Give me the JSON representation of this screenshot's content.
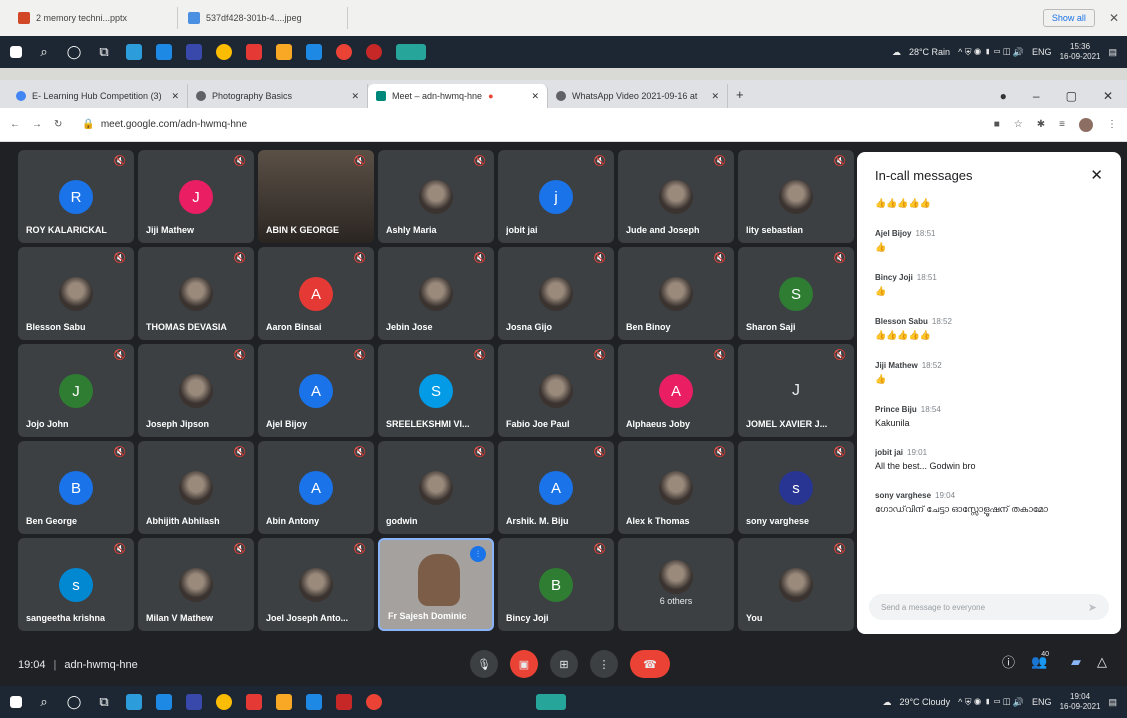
{
  "downloads": {
    "items": [
      "2 memory techni...pptx",
      "537df428-301b-4....jpeg"
    ],
    "show_all": "Show all"
  },
  "taskbar_top": {
    "weather": "28°C Rain",
    "lang": "ENG",
    "time": "15:36",
    "date": "16-09-2021"
  },
  "taskbar_bottom": {
    "weather": "29°C Cloudy",
    "lang": "ENG",
    "time": "19:04",
    "date": "16-09-2021"
  },
  "browser": {
    "tabs": [
      {
        "title": "E- Learning Hub Competition (3)",
        "color": "#4285f4"
      },
      {
        "title": "Photography Basics",
        "color": "#5f6368"
      },
      {
        "title": "Meet – adn-hwmq-hne",
        "color": "#00897b"
      },
      {
        "title": "WhatsApp Video 2021-09-16 at",
        "color": "#5f6368"
      }
    ],
    "url": "meet.google.com/adn-hwmq-hne"
  },
  "meet": {
    "participants": [
      {
        "name": "ROY KALARICKAL",
        "type": "letter",
        "letter": "R",
        "color": "#1a73e8"
      },
      {
        "name": "Jiji Mathew",
        "type": "letter",
        "letter": "J",
        "color": "#e91e63"
      },
      {
        "name": "ABIN K GEORGE",
        "type": "video"
      },
      {
        "name": "Ashly Maria",
        "type": "photo"
      },
      {
        "name": "jobit jai",
        "type": "letter",
        "letter": "j",
        "color": "#1a73e8"
      },
      {
        "name": "Jude and Joseph",
        "type": "photo"
      },
      {
        "name": "lity sebastian",
        "type": "photo"
      },
      {
        "name": "Blesson Sabu",
        "type": "photo"
      },
      {
        "name": "THOMAS DEVASIA",
        "type": "photo"
      },
      {
        "name": "Aaron Binsai",
        "type": "letter",
        "letter": "A",
        "color": "#e53935"
      },
      {
        "name": "Jebin Jose",
        "type": "photo"
      },
      {
        "name": "Josna Gijo",
        "type": "photo"
      },
      {
        "name": "Ben Binoy",
        "type": "photo"
      },
      {
        "name": "Sharon Saji",
        "type": "letter",
        "letter": "S",
        "color": "#2e7d32"
      },
      {
        "name": "Jojo John",
        "type": "letter",
        "letter": "J",
        "color": "#2e7d32"
      },
      {
        "name": "Joseph Jipson",
        "type": "photo"
      },
      {
        "name": "Ajel Bijoy",
        "type": "letter",
        "letter": "A",
        "color": "#1a73e8"
      },
      {
        "name": "SREELEKSHMI VI...",
        "type": "letter",
        "letter": "S",
        "color": "#039be5"
      },
      {
        "name": "Fabio Joe Paul",
        "type": "photo"
      },
      {
        "name": "Alphaeus Joby",
        "type": "letter",
        "letter": "A",
        "color": "#e91e63"
      },
      {
        "name": "JOMEL XAVIER J...",
        "type": "plain",
        "letter": "J"
      },
      {
        "name": "Ben George",
        "type": "letter",
        "letter": "B",
        "color": "#1a73e8"
      },
      {
        "name": "Abhijith Abhilash",
        "type": "photo"
      },
      {
        "name": "Abin Antony",
        "type": "letter",
        "letter": "A",
        "color": "#1a73e8"
      },
      {
        "name": "godwin",
        "type": "photo"
      },
      {
        "name": "Arshik. M. Biju",
        "type": "letter",
        "letter": "A",
        "color": "#1a73e8"
      },
      {
        "name": "Alex k Thomas",
        "type": "photo"
      },
      {
        "name": "sony varghese",
        "type": "letter",
        "letter": "s",
        "color": "#283593"
      },
      {
        "name": "sangeetha krishna",
        "type": "letter",
        "letter": "s",
        "color": "#0288d1"
      },
      {
        "name": "Milan V Mathew",
        "type": "photo"
      },
      {
        "name": "Joel Joseph Anto...",
        "type": "photo"
      },
      {
        "name": "Fr Sajesh Dominic",
        "type": "speaking"
      },
      {
        "name": "Bincy Joji",
        "type": "letter",
        "letter": "B",
        "color": "#2e7d32"
      },
      {
        "name": "6 others",
        "type": "others"
      },
      {
        "name": "You",
        "type": "photo"
      }
    ],
    "meeting_time": "19:04",
    "meeting_code": "adn-hwmq-hne",
    "people_count": "40"
  },
  "chat": {
    "title": "In-call messages",
    "messages": [
      {
        "sender": "",
        "time": "",
        "text": "👍👍👍👍👍"
      },
      {
        "sender": "Ajel Bijoy",
        "time": "18:51",
        "text": "👍"
      },
      {
        "sender": "Bincy Joji",
        "time": "18:51",
        "text": "👍"
      },
      {
        "sender": "Blesson Sabu",
        "time": "18:52",
        "text": "👍👍👍👍👍"
      },
      {
        "sender": "Jiji Mathew",
        "time": "18:52",
        "text": "👍"
      },
      {
        "sender": "Prince Biju",
        "time": "18:54",
        "text": "Kakunila"
      },
      {
        "sender": "jobit jai",
        "time": "19:01",
        "text": "All the best... Godwin bro"
      },
      {
        "sender": "sony varghese",
        "time": "19:04",
        "text": "ഗോഡ്‌വിന് ചേട്ടാ ഓസ്സോളൂഷന് തകാമോ"
      }
    ],
    "composer_placeholder": "Send a message to everyone"
  }
}
